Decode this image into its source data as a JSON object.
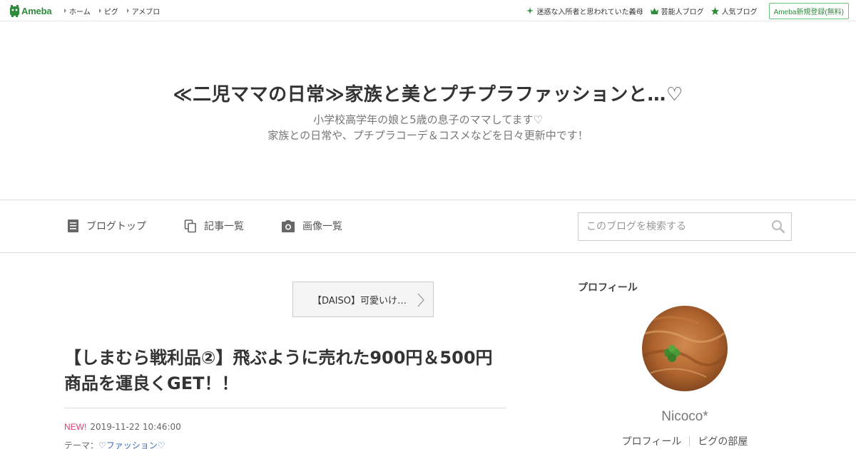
{
  "global_bar": {
    "logo_text": "Ameba",
    "nav": [
      "ホーム",
      "ピグ",
      "アメブロ"
    ],
    "right_links": [
      {
        "label": "迷惑な入所者と思われていた義母",
        "icon": "sparkle-icon"
      },
      {
        "label": "芸能人ブログ",
        "icon": "crown-icon"
      },
      {
        "label": "人気ブログ",
        "icon": "star-icon"
      }
    ],
    "signup_label": "Ameba新規登録(無料)"
  },
  "header": {
    "title": "≪二児ママの日常≫家族と美とプチプラファッションと…♡",
    "description": [
      "小学校高学年の娘と5歳の息子のママしてます♡",
      "家族との日常や、プチプラコーデ＆コスメなどを日々更新中です！"
    ]
  },
  "subnav": {
    "items": [
      {
        "label": "ブログトップ",
        "icon": "document-icon"
      },
      {
        "label": "記事一覧",
        "icon": "copy-icon"
      },
      {
        "label": "画像一覧",
        "icon": "camera-icon"
      }
    ],
    "search_placeholder": "このブログを検索する"
  },
  "article": {
    "prev_link": "【DAISO】可愛いけ…",
    "title": "【しまむら戦利品②】飛ぶように売れた900円＆500円商品を運良くGET！！",
    "new_badge": "NEW!",
    "datetime": "2019-11-22 10:46:00",
    "theme_label": "テーマ：",
    "theme_value": "♡ファッション♡"
  },
  "sidebar": {
    "heading": "プロフィール",
    "name": "Nicoco*",
    "links": [
      "プロフィール",
      "ピグの部屋"
    ]
  },
  "colors": {
    "brand_green": "#2d8c3c",
    "new_pink": "#e4386f",
    "link_blue": "#3a6ab3"
  }
}
